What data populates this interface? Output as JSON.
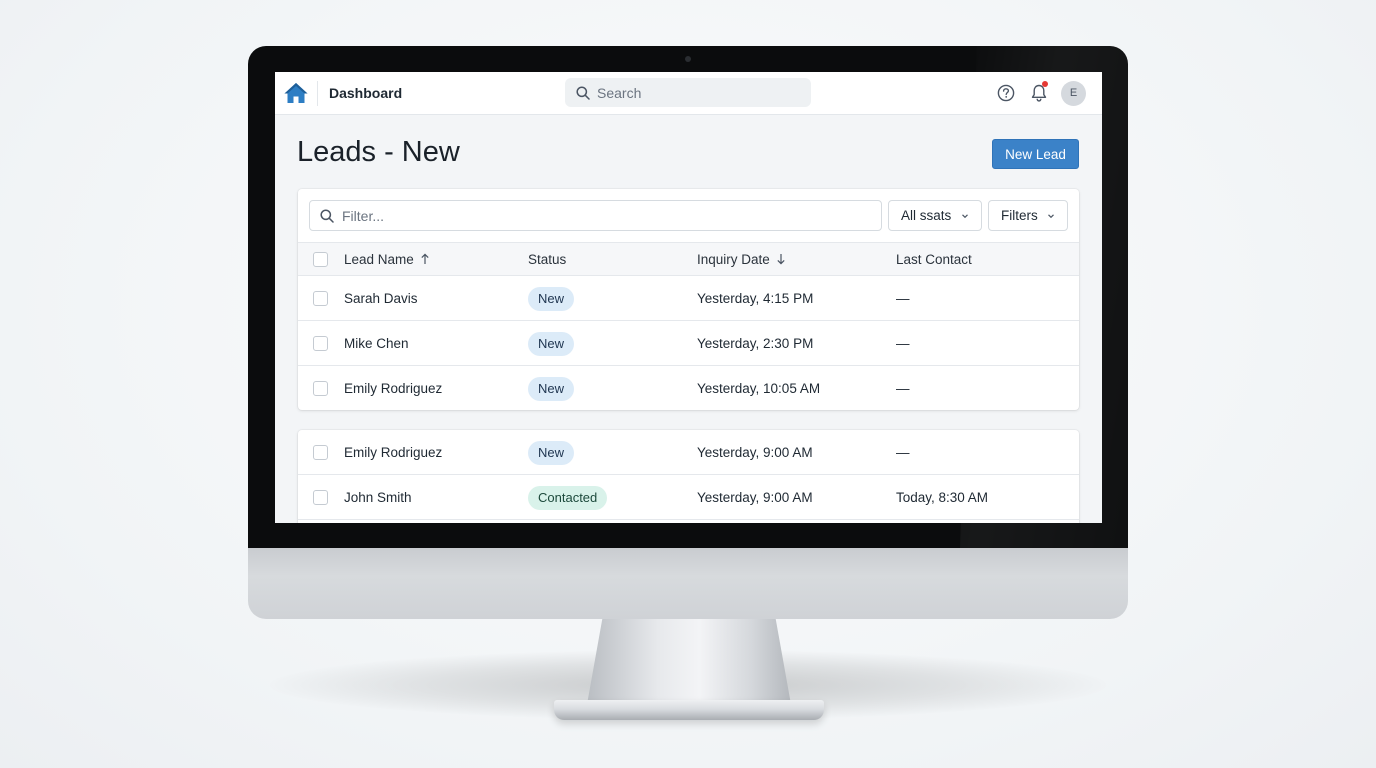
{
  "topbar": {
    "app_title": "Dashboard",
    "search_placeholder": "Search",
    "avatar_initial": "E",
    "icons": [
      "home-icon",
      "search-icon",
      "help-icon",
      "bell-icon"
    ],
    "notification_dot_color": "#e53935"
  },
  "page": {
    "title": "Leads - New",
    "new_lead_label": "New Lead",
    "accent_color": "#3b82c8"
  },
  "toolbar": {
    "filter_placeholder": "Filter...",
    "status_dropdown": "All ssats",
    "filters_dropdown": "Filters"
  },
  "table": {
    "columns": [
      "Lead Name",
      "Status",
      "Inquiry Date",
      "Last Contact"
    ],
    "sort": {
      "Lead Name": "ascending",
      "Inquiry Date": "descending"
    },
    "rows": [
      {
        "name": "Sarah Davis",
        "status": "New",
        "inquiry_date": "Yesterday, 4:15 PM",
        "last_contact": "—"
      },
      {
        "name": "Mike Chen",
        "status": "New",
        "inquiry_date": "Yesterday, 2:30 PM",
        "last_contact": "—"
      },
      {
        "name": "Emily Rodriguez",
        "status": "New",
        "inquiry_date": "Yesterday, 10:05 AM",
        "last_contact": "—"
      },
      {
        "name": "Emily Rodriguez",
        "status": "New",
        "inquiry_date": "Yesterday, 9:00 AM",
        "last_contact": "—"
      },
      {
        "name": "John Smith",
        "status": "Contacted",
        "inquiry_date": "Yesterday, 9:00 AM",
        "last_contact": "Today, 8:30 AM"
      }
    ],
    "status_colors": {
      "New": "#dcebf8",
      "Contacted": "#d9f2ea"
    }
  }
}
